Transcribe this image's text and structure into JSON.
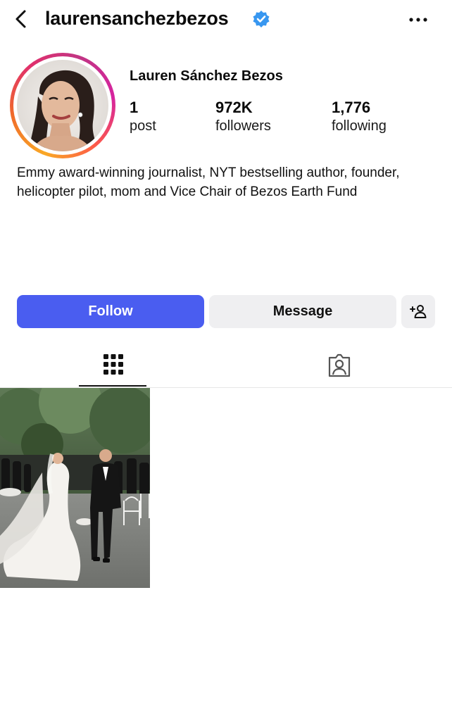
{
  "header": {
    "username": "laurensanchezbezos",
    "back_icon": "chevron-left-icon",
    "verified_icon": "verified-badge-icon",
    "more_icon": "more-horizontal-icon"
  },
  "profile": {
    "full_name": "Lauren Sánchez Bezos",
    "avatar_icon": "profile-photo",
    "stats": [
      {
        "value": "1",
        "label": "post"
      },
      {
        "value": "972K",
        "label": "followers"
      },
      {
        "value": "1,776",
        "label": "following"
      }
    ],
    "bio": "Emmy award-winning journalist, NYT bestselling author, founder, helicopter pilot, mom and Vice Chair of Bezos Earth Fund"
  },
  "actions": {
    "follow_label": "Follow",
    "message_label": "Message",
    "add_person_icon": "add-person-icon"
  },
  "tabs": [
    {
      "name": "grid",
      "icon": "grid-icon",
      "active": true
    },
    {
      "name": "tagged",
      "icon": "tagged-person-icon",
      "active": false
    }
  ],
  "posts": [
    {
      "icon": "wedding-photo-thumbnail"
    }
  ],
  "colors": {
    "follow_button": "#4a5df0",
    "secondary_button": "#efeff1",
    "verified_badge": "#3897f0"
  }
}
